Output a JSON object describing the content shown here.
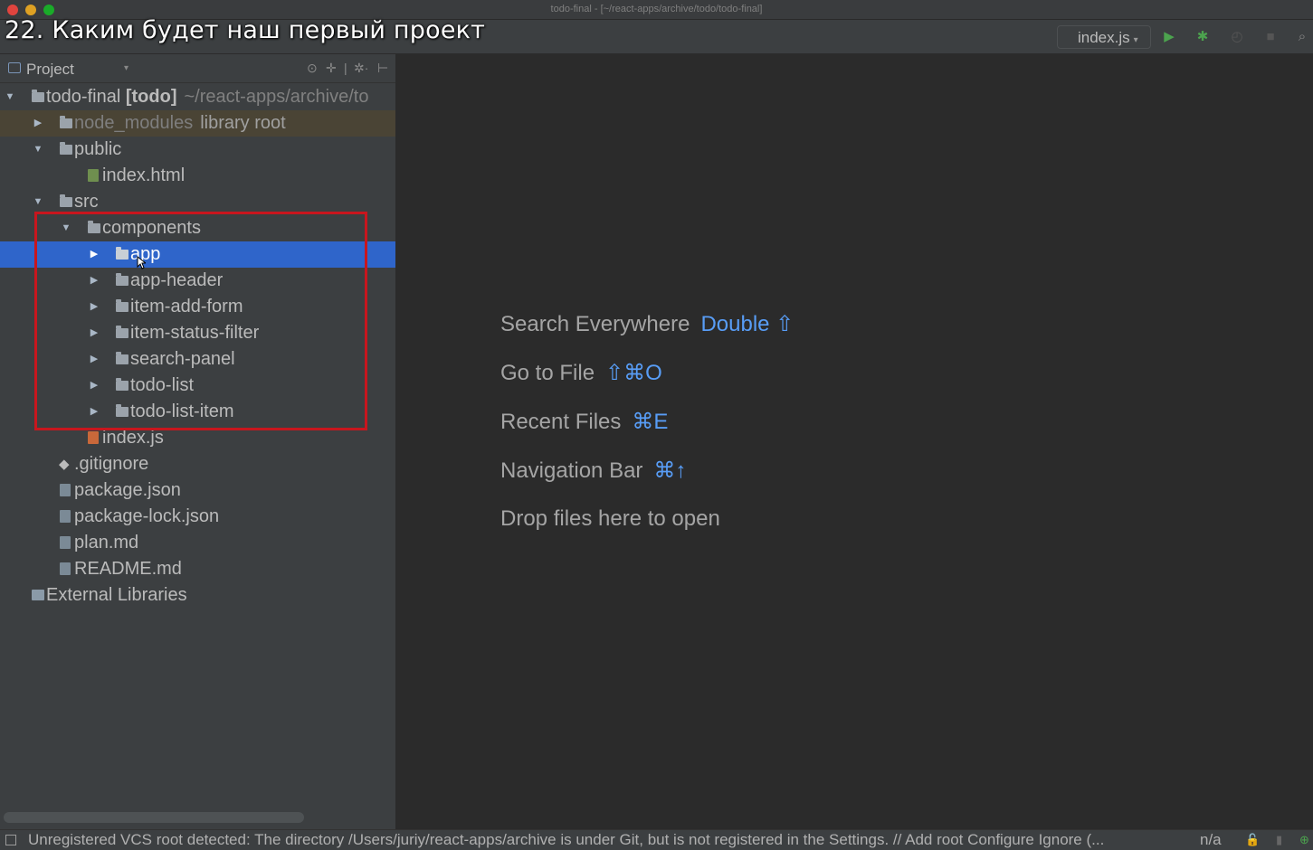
{
  "window": {
    "title": "todo-final - [~/react-apps/archive/todo/todo-final]"
  },
  "caption": "22. Каким будет наш первый проект",
  "toolbar": {
    "run_config": "index.js",
    "play_icon": "▶",
    "debug_icon": "✱",
    "coverage_icon": "◴",
    "stop_icon": "■",
    "search_icon": "⌕"
  },
  "project_panel": {
    "title": "Project",
    "dropdown_icon": "▾",
    "header_icons": [
      "⊙",
      "✛",
      "|",
      "✲·",
      "⊢"
    ],
    "root": {
      "name": "todo-final",
      "module": "[todo]",
      "path": "~/react-apps/archive/to"
    },
    "node_modules": {
      "name": "node_modules",
      "extra": "library root"
    },
    "public": "public",
    "index_html": "index.html",
    "src": "src",
    "components": "components",
    "component_folders": [
      "app",
      "app-header",
      "item-add-form",
      "item-status-filter",
      "search-panel",
      "todo-list",
      "todo-list-item"
    ],
    "index_js": "index.js",
    "root_files": [
      ".gitignore",
      "package.json",
      "package-lock.json",
      "plan.md",
      "README.md"
    ],
    "external_libraries": "External Libraries"
  },
  "editor_hints": [
    {
      "label": "Search Everywhere",
      "shortcut": "Double ⇧"
    },
    {
      "label": "Go to File",
      "shortcut": "⇧⌘O"
    },
    {
      "label": "Recent Files",
      "shortcut": "⌘E"
    },
    {
      "label": "Navigation Bar",
      "shortcut": "⌘↑"
    },
    {
      "label": "Drop files here to open",
      "shortcut": ""
    }
  ],
  "status_bar": {
    "message": "Unregistered VCS root detected: The directory /Users/juriy/react-apps/archive is under Git, but is not registered in the Settings. // Add root  Configure  Ignore (...",
    "position": "n/a",
    "lock_icon": "🔓",
    "git_icon": "⊕"
  },
  "colors": {
    "selection": "#2f65ca",
    "highlight_box": "#c8161e",
    "shortcut_blue": "#589df6",
    "panel_bg": "#3c3f41",
    "editor_bg": "#2b2b2b"
  }
}
